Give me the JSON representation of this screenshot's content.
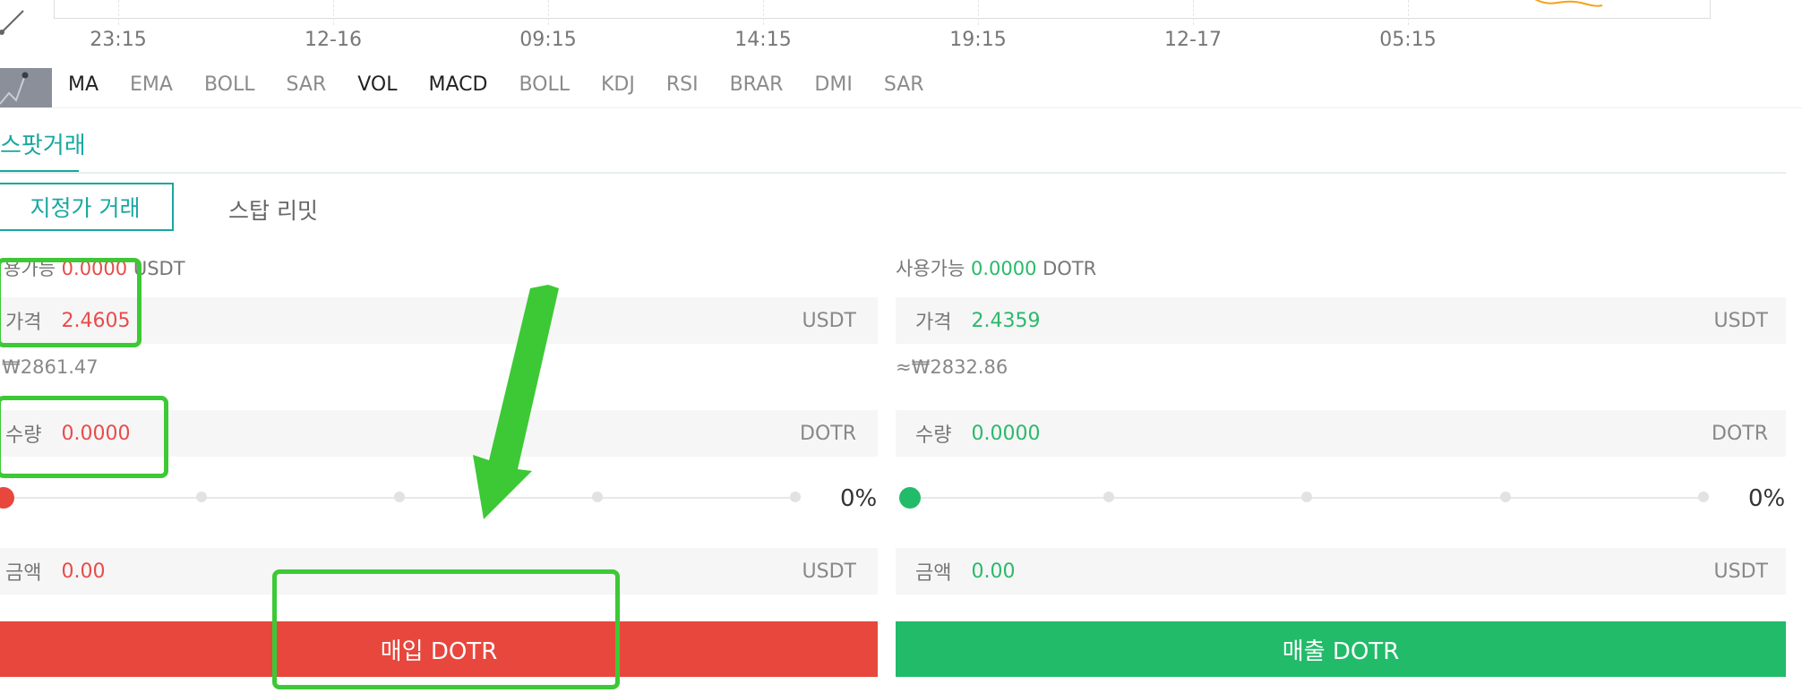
{
  "chart": {
    "time_labels": [
      "23:15",
      "12-16",
      "09:15",
      "14:15",
      "19:15",
      "12-17",
      "05:15"
    ]
  },
  "indicators": [
    {
      "label": "MA",
      "active": true
    },
    {
      "label": "EMA",
      "active": false
    },
    {
      "label": "BOLL",
      "active": false
    },
    {
      "label": "SAR",
      "active": false
    },
    {
      "label": "VOL",
      "active": true
    },
    {
      "label": "MACD",
      "active": true
    },
    {
      "label": "BOLL",
      "active": false
    },
    {
      "label": "KDJ",
      "active": false
    },
    {
      "label": "RSI",
      "active": false
    },
    {
      "label": "BRAR",
      "active": false
    },
    {
      "label": "DMI",
      "active": false
    },
    {
      "label": "SAR",
      "active": false
    }
  ],
  "tab": {
    "label": "스팟거래"
  },
  "order_types": {
    "limit": "지정가 거래",
    "stop": "스탑 리밋"
  },
  "buy": {
    "avail_label": "용가능",
    "avail_value": "0.0000",
    "avail_unit": "USDT",
    "price_label": "가격",
    "price_value": "2.4605",
    "price_unit": "USDT",
    "approx": "₩2861.47",
    "qty_label": "수량",
    "qty_value": "0.0000",
    "qty_unit": "DOTR",
    "percent": "0%",
    "amount_label": "금액",
    "amount_value": "0.00",
    "amount_unit": "USDT",
    "button": "매입 DOTR",
    "color": "#e8473d"
  },
  "sell": {
    "avail_label": "사용가능",
    "avail_value": "0.0000",
    "avail_unit": "DOTR",
    "price_label": "가격",
    "price_value": "2.4359",
    "price_unit": "USDT",
    "approx": "≈₩2832.86",
    "qty_label": "수량",
    "qty_value": "0.0000",
    "qty_unit": "DOTR",
    "percent": "0%",
    "amount_label": "금액",
    "amount_value": "0.00",
    "amount_unit": "USDT",
    "button": "매출 DOTR",
    "color": "#22bb6a"
  },
  "accent": "#19a7a0",
  "annotation_color": "#3cc935"
}
